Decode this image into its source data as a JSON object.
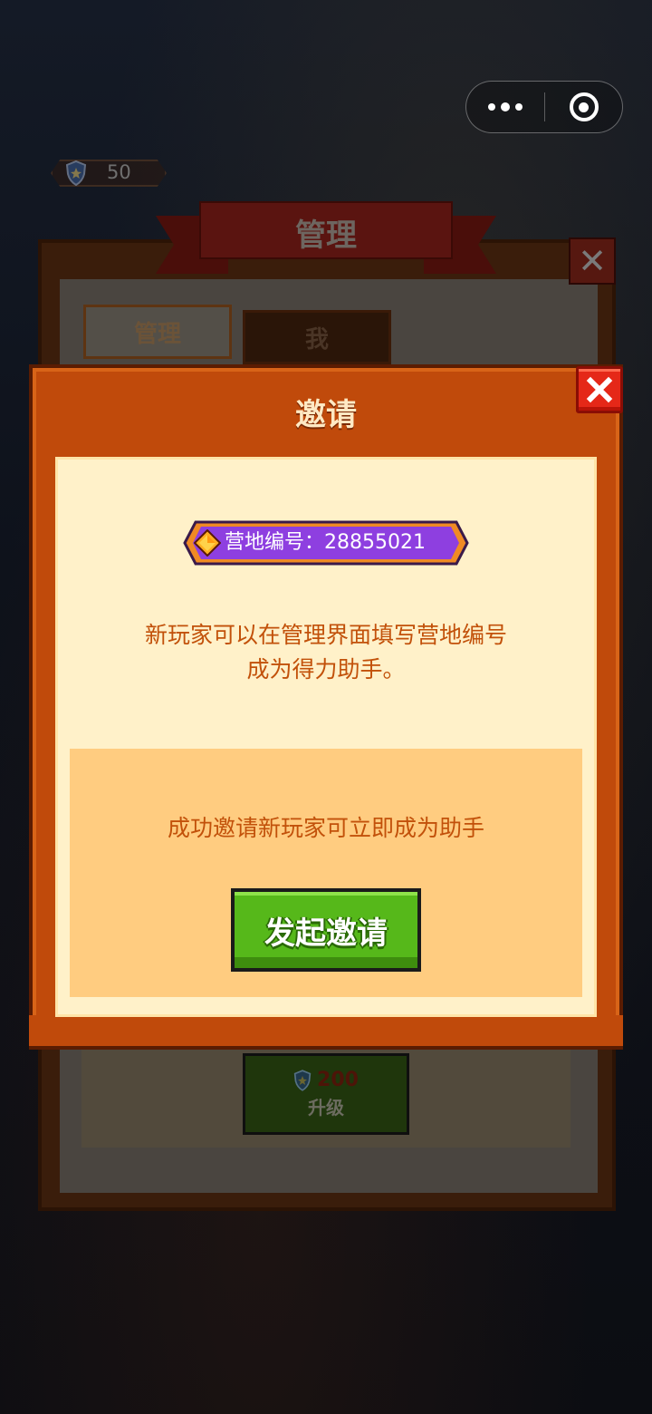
{
  "capsule": {
    "more_icon": "more-dots-icon",
    "close_icon": "target-circle-icon"
  },
  "top_counter": {
    "icon": "shield-star-icon",
    "value": "50"
  },
  "background_panel": {
    "title": "管理",
    "tabs": [
      "管理",
      "我"
    ],
    "upgrade": {
      "cost": "200",
      "label": "升级"
    }
  },
  "modal": {
    "title": "邀请",
    "camp_id_label": "营地编号：28855021",
    "description_line1": "新玩家可以在管理界面填写营地编号",
    "description_line2": "成为得力助手。",
    "sub_text": "成功邀请新玩家可立即成为助手",
    "invite_button": "发起邀请"
  },
  "colors": {
    "modal_frame": "#c04a0b",
    "content_bg": "#fff1c9",
    "accent_text": "#c2510a",
    "badge_purple": "#8e3fe0",
    "button_green": "#56b81a",
    "close_red": "#e52818"
  }
}
